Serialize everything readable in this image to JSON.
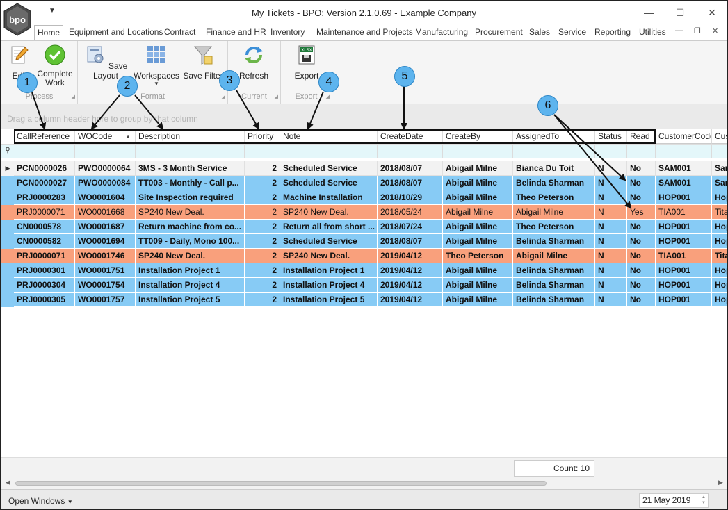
{
  "window": {
    "title": "My Tickets - BPO: Version 2.1.0.69 - Example Company",
    "logo_text": "bpo"
  },
  "tabs": [
    "Home",
    "Equipment and Locations",
    "Contract",
    "Finance and HR",
    "Inventory",
    "Maintenance and Projects",
    "Manufacturing",
    "Procurement",
    "Sales",
    "Service",
    "Reporting",
    "Utilities"
  ],
  "ribbon": {
    "groups": {
      "process": "Process",
      "format": "Format",
      "current": "Current",
      "export": "Export"
    },
    "buttons": {
      "edit": "Edit",
      "complete_line1": "Complete",
      "complete_line2": "Work",
      "save_layout": "Save Layout",
      "workspaces": "Workspaces",
      "save_filter": "Save Filter",
      "refresh": "Refresh",
      "export": "Export"
    }
  },
  "grid": {
    "group_hint": "Drag a column header here to group by that column",
    "columns": [
      "CallReference",
      "WOCode",
      "Description",
      "Priority",
      "Note",
      "CreateDate",
      "CreateBy",
      "AssignedTo",
      "Status",
      "Read",
      "CustomerCode",
      "Cus"
    ],
    "rows": [
      {
        "color": "gray",
        "cells": [
          "PCN0000026",
          "PWO0000064",
          "3MS - 3 Month Service",
          "2",
          "Scheduled Service",
          "2018/08/07",
          "Abigail Milne",
          "Bianca Du Toit",
          "N",
          "No",
          "SAM001",
          "Sar"
        ]
      },
      {
        "color": "blue",
        "cells": [
          "PCN0000027",
          "PWO0000084",
          "TT003 -  Monthly - Call p...",
          "2",
          "Scheduled Service",
          "2018/08/07",
          "Abigail Milne",
          "Belinda Sharman",
          "N",
          "No",
          "SAM001",
          "Sar"
        ]
      },
      {
        "color": "blue",
        "cells": [
          "PRJ0000283",
          "WO0001604",
          "Site Inspection required",
          "2",
          "Machine Installation",
          "2018/10/29",
          "Abigail Milne",
          "Theo Peterson",
          "N",
          "No",
          "HOP001",
          "Hop"
        ]
      },
      {
        "color": "orange-light",
        "cells": [
          "PRJ0000071",
          "WO0001668",
          "SP240 New Deal.",
          "2",
          "SP240 New Deal.",
          "2018/05/24",
          "Abigail Milne",
          "Abigail Milne",
          "N",
          "Yes",
          "TIA001",
          "Tita"
        ]
      },
      {
        "color": "blue",
        "cells": [
          "CN0000578",
          "WO0001687",
          "Return machine from co...",
          "2",
          "Return all from short ...",
          "2018/07/24",
          "Abigail Milne",
          "Theo Peterson",
          "N",
          "No",
          "HOP001",
          "Hop"
        ]
      },
      {
        "color": "blue",
        "cells": [
          "CN0000582",
          "WO0001694",
          "TT009 - Daily, Mono 100...",
          "2",
          "Scheduled Service",
          "2018/08/07",
          "Abigail Milne",
          "Belinda Sharman",
          "N",
          "No",
          "HOP001",
          "Hop"
        ]
      },
      {
        "color": "orange",
        "cells": [
          "PRJ0000071",
          "WO0001746",
          "SP240 New Deal.",
          "2",
          "SP240 New Deal.",
          "2019/04/12",
          "Theo Peterson",
          "Abigail Milne",
          "N",
          "No",
          "TIA001",
          "Tita"
        ]
      },
      {
        "color": "blue",
        "cells": [
          "PRJ0000301",
          "WO0001751",
          "Installation Project 1",
          "2",
          "Installation Project 1",
          "2019/04/12",
          "Abigail Milne",
          "Belinda Sharman",
          "N",
          "No",
          "HOP001",
          "Hop"
        ]
      },
      {
        "color": "blue",
        "cells": [
          "PRJ0000304",
          "WO0001754",
          "Installation Project 4",
          "2",
          "Installation Project 4",
          "2019/04/12",
          "Abigail Milne",
          "Belinda Sharman",
          "N",
          "No",
          "HOP001",
          "Hop"
        ]
      },
      {
        "color": "blue",
        "cells": [
          "PRJ0000305",
          "WO0001757",
          "Installation Project 5",
          "2",
          "Installation Project 5",
          "2019/04/12",
          "Abigail Milne",
          "Belinda Sharman",
          "N",
          "No",
          "HOP001",
          "Hop"
        ]
      }
    ],
    "count_label": "Count: 10"
  },
  "annotations": [
    "1",
    "2",
    "3",
    "4",
    "5",
    "6"
  ],
  "status": {
    "open_windows": "Open Windows",
    "date": "21 May 2019"
  },
  "colors": {
    "row_blue": "#87cbf5",
    "row_orange": "#f9a07c",
    "badge": "#5db4ee",
    "filter_row": "#e4f7fa"
  }
}
